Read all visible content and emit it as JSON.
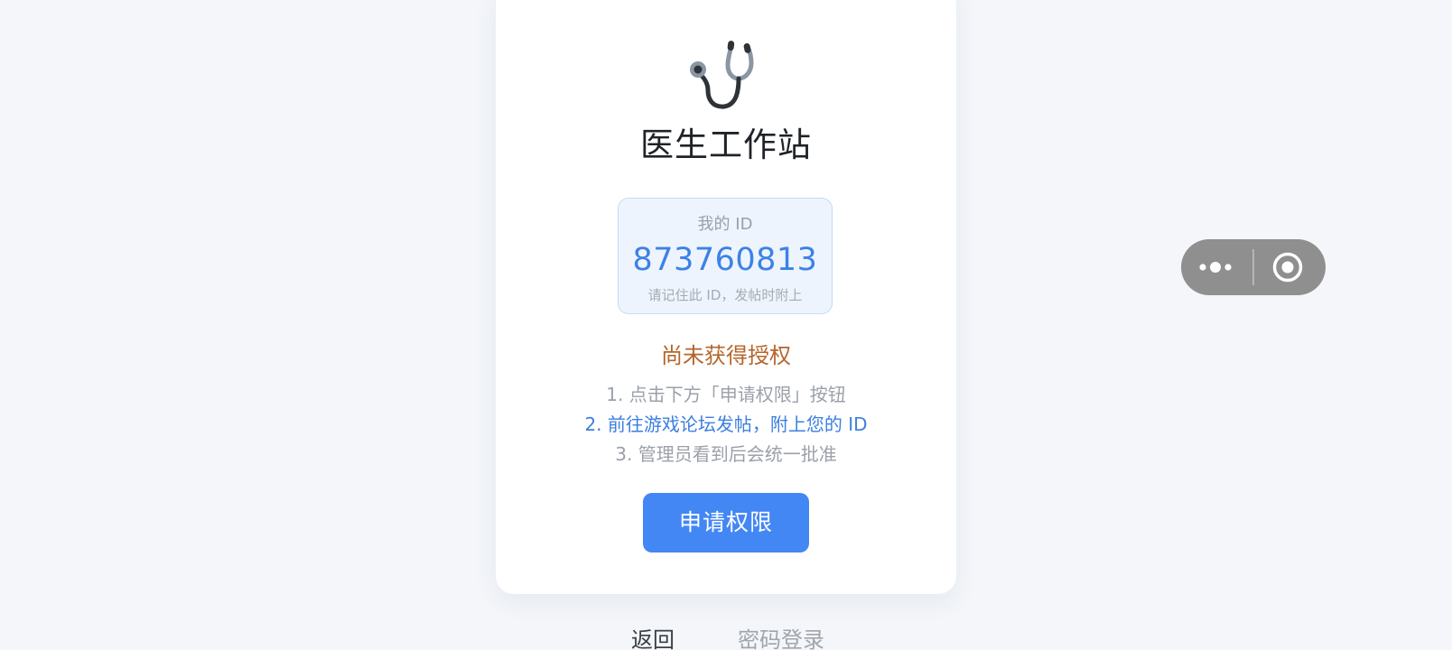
{
  "app": {
    "title": "医生工作站",
    "logo_icon": "stethoscope-icon"
  },
  "id_card": {
    "label": "我的 ID",
    "value": "873760813",
    "hint": "请记住此 ID，发帖时附上"
  },
  "status": {
    "text": "尚未获得授权"
  },
  "steps": [
    "1. 点击下方「申请权限」按钮",
    "2. 前往游戏论坛发帖，附上您的 ID",
    "3. 管理员看到后会统一批准"
  ],
  "actions": {
    "apply_label": "申请权限",
    "back_label": "返回",
    "password_login_label": "密码登录"
  },
  "capsule": {
    "more_icon": "more-dots-icon",
    "close_icon": "target-circle-icon"
  },
  "colors": {
    "background": "#f4f6fa",
    "accent": "#4387f4",
    "id_value": "#3c82e6",
    "status": "#b5652a",
    "highlight_step": "#3c7fe0"
  }
}
